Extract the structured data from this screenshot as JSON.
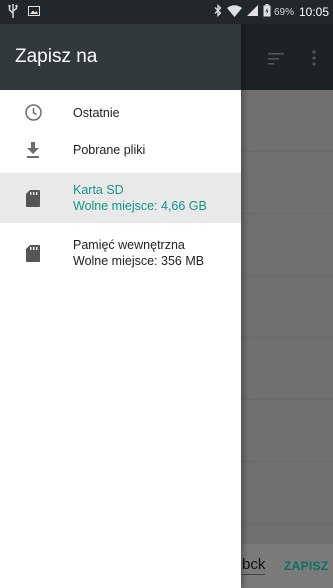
{
  "status_bar": {
    "battery_percent": "69%",
    "time": "10:05",
    "icons": [
      "usb-icon",
      "image-icon",
      "bluetooth-icon",
      "wifi-icon",
      "signal-icon",
      "battery-icon"
    ]
  },
  "background": {
    "filename_partial": "bck",
    "save_label": "ZAPISZ",
    "icons": [
      "sort-icon",
      "more-vert-icon"
    ]
  },
  "drawer": {
    "title": "Zapisz na",
    "items": [
      {
        "label": "Ostatnie",
        "icon": "clock-icon"
      },
      {
        "label": "Pobrane pliki",
        "icon": "download-icon"
      },
      {
        "label": "Karta SD",
        "sub": "Wolne miejsce: 4,66 GB",
        "icon": "sd-card-icon",
        "selected": true
      },
      {
        "label": "Pamięć wewnętrzna",
        "sub": "Wolne miejsce: 356 MB",
        "icon": "internal-storage-icon"
      }
    ]
  },
  "colors": {
    "accent": "#139684",
    "header": "#31393c",
    "statusbar": "#22272b"
  }
}
